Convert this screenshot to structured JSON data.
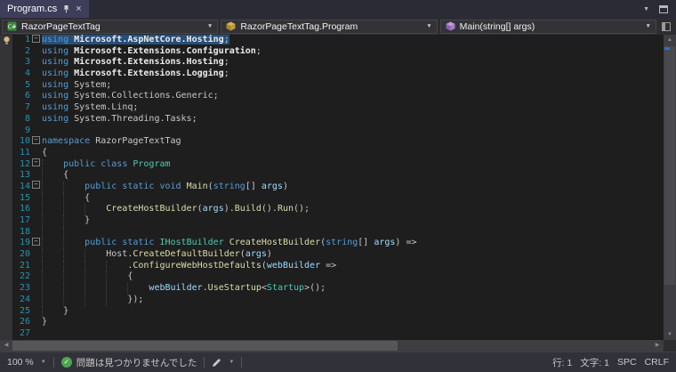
{
  "colors": {
    "editor_bg": "#1E1E1E",
    "chrome_bg": "#2D2D30",
    "tab_active_bg": "#3E3E5B",
    "selection_bg": "#264F78",
    "keyword": "#569CD6",
    "type_name": "#4EC9B0",
    "method_name": "#DCDCAA",
    "parameter": "#9CDCFE",
    "plain_text": "#C8C8C8",
    "line_number": "#2B91AF",
    "health_ok_green": "#4CA64C"
  },
  "icons": {
    "close": "×",
    "chevron_down": "▼",
    "fold_collapse": "−",
    "check": "✓",
    "scroll_up": "▲",
    "scroll_down": "▼",
    "scroll_left": "◀",
    "scroll_right": "▶",
    "pin": "svg-pushpin",
    "pencil": "svg-pencil",
    "lightbulb": "svg-lightbulb",
    "project": "svg-csharp-project",
    "class": "svg-class-cube",
    "method": "svg-method-cube"
  },
  "tab_bar": {
    "tab": {
      "title": "Program.cs",
      "pinned": true,
      "active": true
    }
  },
  "nav_bar": {
    "project_dropdown": "RazorPageTextTag",
    "type_dropdown": "RazorPageTextTag.Program",
    "member_dropdown": "Main(string[] args)"
  },
  "editor": {
    "lines": [
      {
        "n": 1,
        "fold": true,
        "sel": true,
        "bulb": true,
        "tokens": [
          [
            "k",
            "using"
          ],
          [
            "b",
            " Microsoft.AspNetCore.Hosting"
          ],
          [
            "t",
            ";"
          ]
        ]
      },
      {
        "n": 2,
        "tokens": [
          [
            "k",
            "using"
          ],
          [
            "b",
            " Microsoft.Extensions.Configuration"
          ],
          [
            "t",
            ";"
          ]
        ]
      },
      {
        "n": 3,
        "tokens": [
          [
            "k",
            "using"
          ],
          [
            "b",
            " Microsoft.Extensions.Hosting"
          ],
          [
            "t",
            ";"
          ]
        ]
      },
      {
        "n": 4,
        "tokens": [
          [
            "k",
            "using"
          ],
          [
            "b",
            " Microsoft.Extensions.Logging"
          ],
          [
            "t",
            ";"
          ]
        ]
      },
      {
        "n": 5,
        "tokens": [
          [
            "k",
            "using"
          ],
          [
            "t",
            " System;"
          ]
        ]
      },
      {
        "n": 6,
        "tokens": [
          [
            "k",
            "using"
          ],
          [
            "t",
            " System.Collections.Generic;"
          ]
        ]
      },
      {
        "n": 7,
        "tokens": [
          [
            "k",
            "using"
          ],
          [
            "t",
            " System.Linq;"
          ]
        ]
      },
      {
        "n": 8,
        "tokens": [
          [
            "k",
            "using"
          ],
          [
            "t",
            " System.Threading.Tasks;"
          ]
        ]
      },
      {
        "n": 9
      },
      {
        "n": 10,
        "fold": true,
        "tokens": [
          [
            "k",
            "namespace"
          ],
          [
            "t",
            " RazorPageTextTag"
          ]
        ]
      },
      {
        "n": 11,
        "tokens": [
          [
            "t",
            "{"
          ]
        ]
      },
      {
        "n": 12,
        "fold": true,
        "guides": [
          0
        ],
        "tokens": [
          [
            "t",
            "    "
          ],
          [
            "k",
            "public class "
          ],
          [
            "c",
            "Program"
          ]
        ]
      },
      {
        "n": 13,
        "guides": [
          0
        ],
        "tokens": [
          [
            "t",
            "    {"
          ]
        ]
      },
      {
        "n": 14,
        "fold": true,
        "guides": [
          0,
          4
        ],
        "tokens": [
          [
            "t",
            "        "
          ],
          [
            "k",
            "public static void "
          ],
          [
            "y",
            "Main"
          ],
          [
            "t",
            "("
          ],
          [
            "k",
            "string"
          ],
          [
            "t",
            "[] "
          ],
          [
            "p",
            "args"
          ],
          [
            "t",
            ")"
          ]
        ]
      },
      {
        "n": 15,
        "guides": [
          0,
          4
        ],
        "tokens": [
          [
            "t",
            "        {"
          ]
        ]
      },
      {
        "n": 16,
        "guides": [
          0,
          4,
          8
        ],
        "tokens": [
          [
            "t",
            "            "
          ],
          [
            "y",
            "CreateHostBuilder"
          ],
          [
            "t",
            "("
          ],
          [
            "p",
            "args"
          ],
          [
            "t",
            ")."
          ],
          [
            "y",
            "Build"
          ],
          [
            "t",
            "()."
          ],
          [
            "y",
            "Run"
          ],
          [
            "t",
            "();"
          ]
        ]
      },
      {
        "n": 17,
        "guides": [
          0,
          4
        ],
        "tokens": [
          [
            "t",
            "        }"
          ]
        ]
      },
      {
        "n": 18,
        "guides": [
          0,
          4
        ]
      },
      {
        "n": 19,
        "fold": true,
        "guides": [
          0,
          4
        ],
        "tokens": [
          [
            "t",
            "        "
          ],
          [
            "k",
            "public static "
          ],
          [
            "c",
            "IHostBuilder"
          ],
          [
            "t",
            " "
          ],
          [
            "y",
            "CreateHostBuilder"
          ],
          [
            "t",
            "("
          ],
          [
            "k",
            "string"
          ],
          [
            "t",
            "[] "
          ],
          [
            "p",
            "args"
          ],
          [
            "t",
            ") =>"
          ]
        ]
      },
      {
        "n": 20,
        "guides": [
          0,
          4,
          8
        ],
        "tokens": [
          [
            "t",
            "            Host."
          ],
          [
            "y",
            "CreateDefaultBuilder"
          ],
          [
            "t",
            "("
          ],
          [
            "p",
            "args"
          ],
          [
            "t",
            ")"
          ]
        ]
      },
      {
        "n": 21,
        "guides": [
          0,
          4,
          8,
          12
        ],
        "tokens": [
          [
            "t",
            "                ."
          ],
          [
            "y",
            "ConfigureWebHostDefaults"
          ],
          [
            "t",
            "("
          ],
          [
            "p",
            "webBuilder"
          ],
          [
            "t",
            " =>"
          ]
        ]
      },
      {
        "n": 22,
        "guides": [
          0,
          4,
          8,
          12
        ],
        "tokens": [
          [
            "t",
            "                {"
          ]
        ]
      },
      {
        "n": 23,
        "guides": [
          0,
          4,
          8,
          12,
          16
        ],
        "tokens": [
          [
            "t",
            "                    "
          ],
          [
            "p",
            "webBuilder"
          ],
          [
            "t",
            "."
          ],
          [
            "y",
            "UseStartup"
          ],
          [
            "t",
            "<"
          ],
          [
            "c",
            "Startup"
          ],
          [
            "t",
            ">();"
          ]
        ]
      },
      {
        "n": 24,
        "guides": [
          0,
          4,
          8,
          12
        ],
        "tokens": [
          [
            "t",
            "                });"
          ]
        ]
      },
      {
        "n": 25,
        "guides": [
          0
        ],
        "tokens": [
          [
            "t",
            "    }"
          ]
        ]
      },
      {
        "n": 26,
        "tokens": [
          [
            "t",
            "}"
          ]
        ]
      },
      {
        "n": 27
      }
    ]
  },
  "status_bar": {
    "zoom": "100 %",
    "health_text": "問題は見つかりませんでした",
    "line": "行: 1",
    "column": "文字: 1",
    "whitespace": "SPC",
    "eol": "CRLF"
  }
}
